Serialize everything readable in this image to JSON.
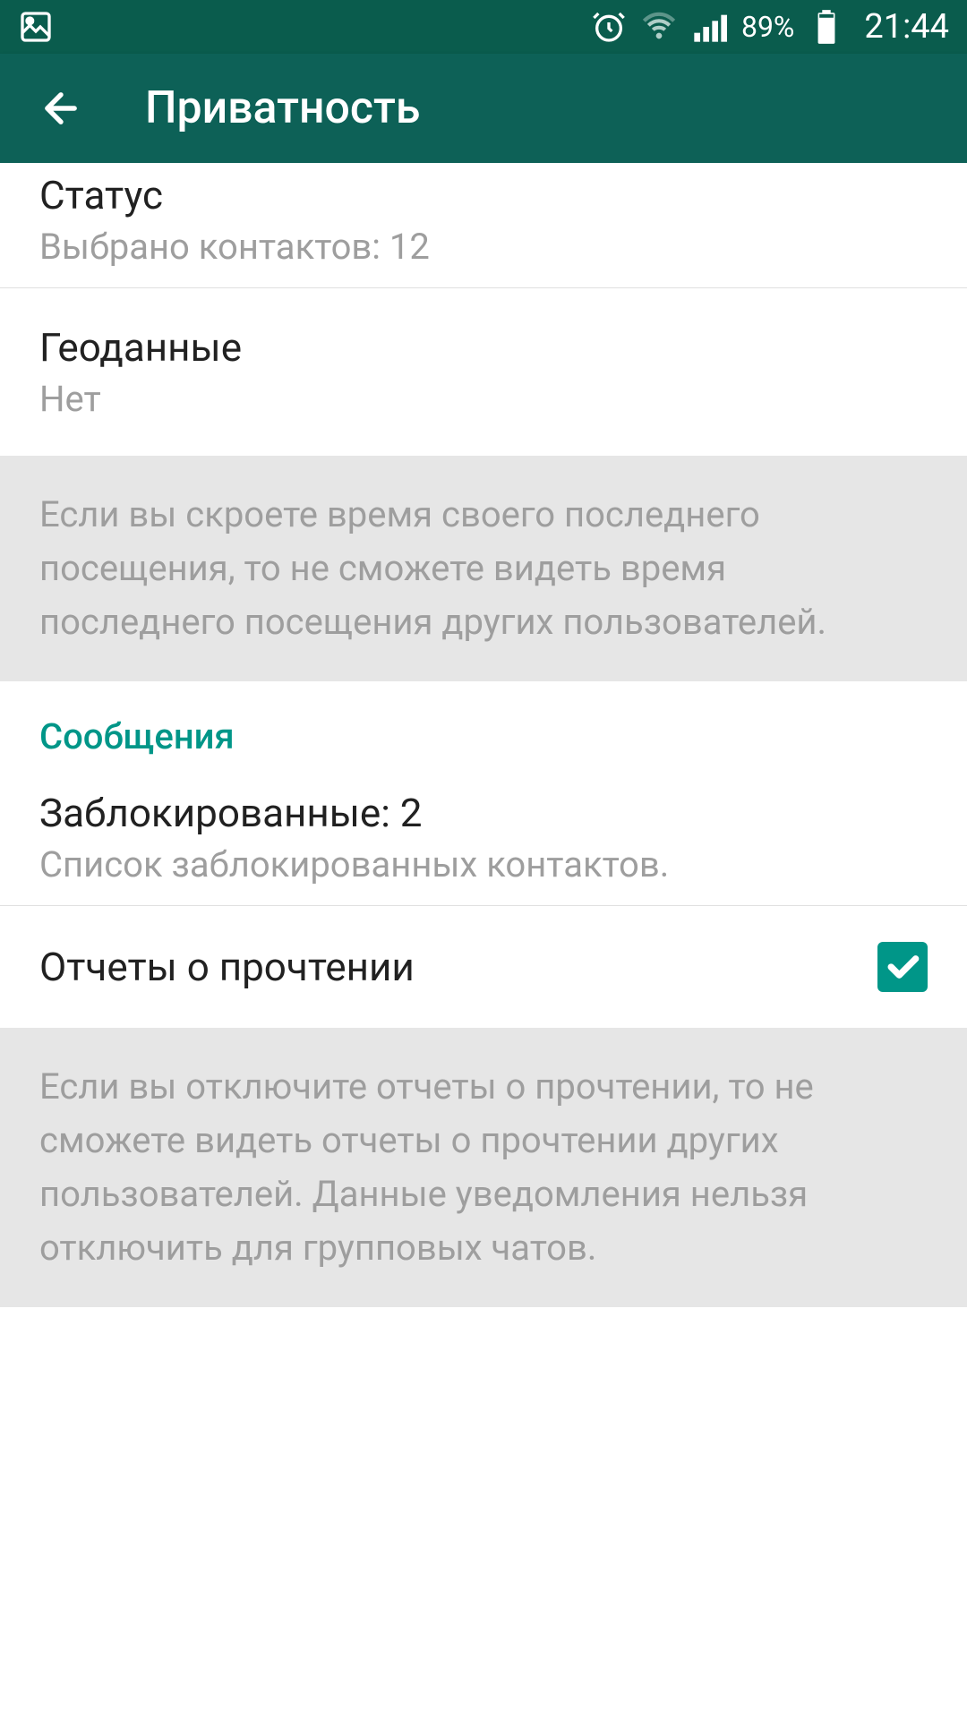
{
  "statusBar": {
    "batteryPercent": "89%",
    "time": "21:44"
  },
  "appBar": {
    "title": "Приватность"
  },
  "items": {
    "status": {
      "title": "Статус",
      "subtitle": "Выбрано контактов: 12"
    },
    "location": {
      "title": "Геоданные",
      "subtitle": "Нет"
    },
    "lastSeenInfo": "Если вы скроете время своего последнего посещения, то не сможете видеть время последнего посещения других пользователей.",
    "sectionMessages": "Сообщения",
    "blocked": {
      "title": "Заблокированные: 2",
      "subtitle": "Список заблокированных контактов."
    },
    "readReceipts": {
      "title": "Отчеты о прочтении"
    },
    "readReceiptsInfo": "Если вы отключите отчеты о прочтении, то не сможете видеть отчеты о прочтении других пользователей. Данные уведомления нельзя отключить для групповых чатов."
  }
}
